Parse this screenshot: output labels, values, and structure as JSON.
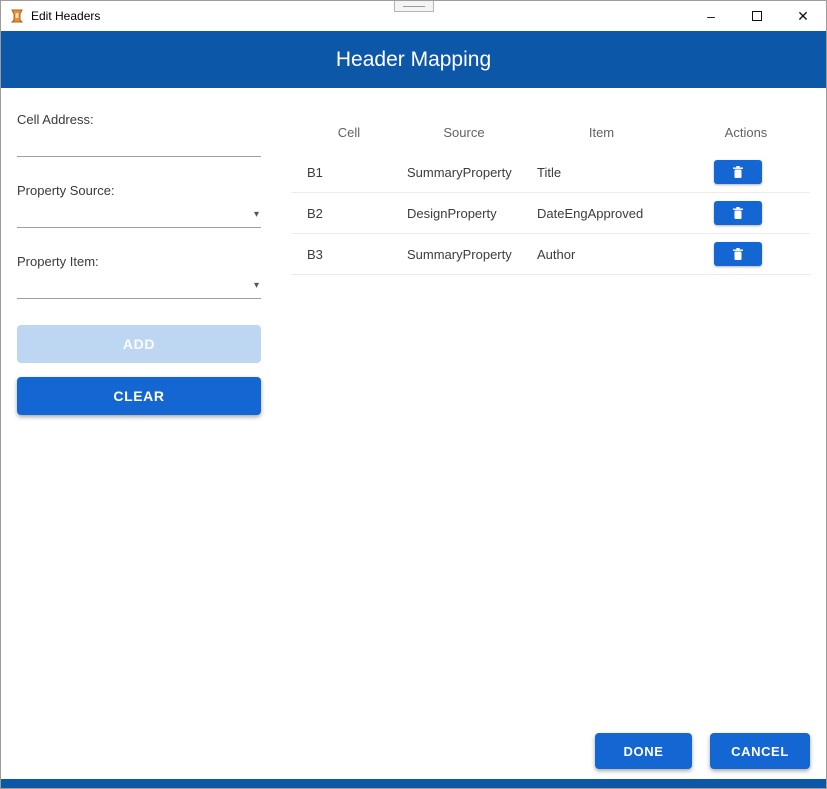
{
  "window": {
    "title": "Edit Headers",
    "minimize_icon": "–",
    "close_icon": "✕"
  },
  "banner": {
    "title": "Header Mapping"
  },
  "form": {
    "cell_address": {
      "label": "Cell Address:",
      "value": ""
    },
    "property_source": {
      "label": "Property Source:",
      "value": "",
      "chevron_icon": "▾"
    },
    "property_item": {
      "label": "Property Item:",
      "value": "",
      "chevron_icon": "▾"
    },
    "add_button": "ADD",
    "clear_button": "CLEAR"
  },
  "table": {
    "columns": {
      "cell": "Cell",
      "source": "Source",
      "item": "Item",
      "actions": "Actions"
    },
    "rows": [
      {
        "cell": "B1",
        "source": "SummaryProperty",
        "item": "Title"
      },
      {
        "cell": "B2",
        "source": "DesignProperty",
        "item": "DateEngApproved"
      },
      {
        "cell": "B3",
        "source": "SummaryProperty",
        "item": "Author"
      }
    ]
  },
  "footer": {
    "done": "DONE",
    "cancel": "CANCEL"
  },
  "colors": {
    "banner_blue": "#0d57a8",
    "button_blue": "#1467d2",
    "disabled_blue": "#bdd7f3"
  }
}
